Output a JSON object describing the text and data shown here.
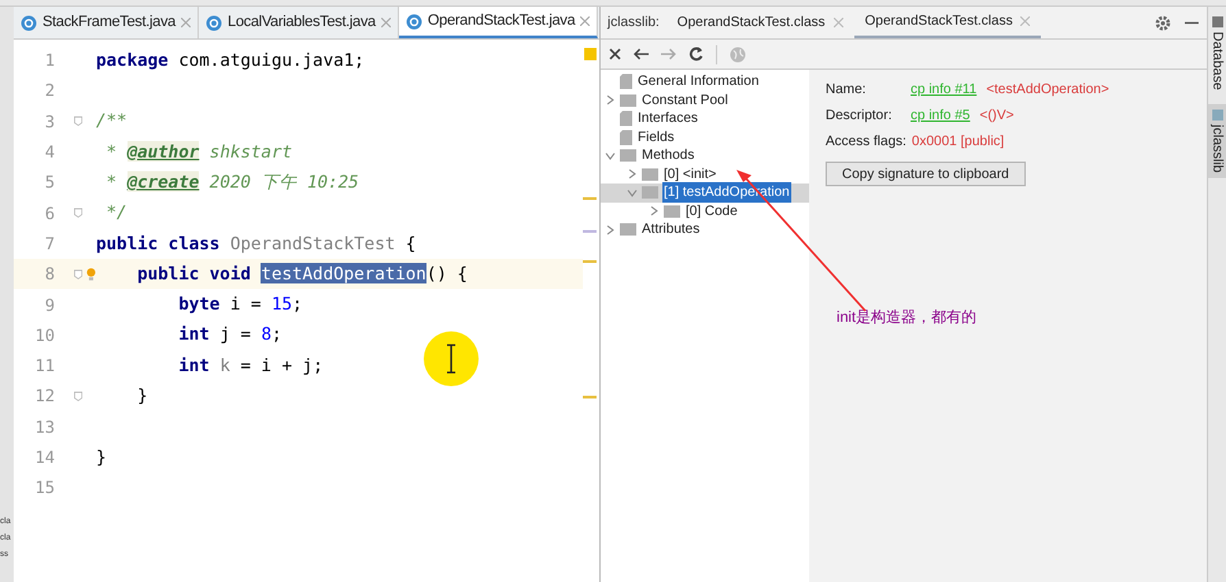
{
  "editor_tabs": [
    {
      "label": "StackFrameTest.java",
      "selected": false
    },
    {
      "label": "LocalVariablesTest.java",
      "selected": false
    },
    {
      "label": "OperandStackTest.java",
      "selected": true
    }
  ],
  "left_strip": [
    "cla",
    "cla",
    "ss"
  ],
  "code_lines": [
    {
      "number": "1",
      "tokens": [
        {
          "kind": "keyword",
          "text": "package"
        },
        {
          "kind": "plain",
          "text": " com.atguigu.java1;"
        }
      ]
    },
    {
      "number": "2"
    },
    {
      "number": "3",
      "fold": true,
      "tokens": [
        {
          "kind": "comment",
          "text": "/**"
        }
      ]
    },
    {
      "number": "4",
      "tokens": [
        {
          "kind": "comment",
          "text": " * "
        },
        {
          "kind": "tag",
          "text": "@author"
        },
        {
          "kind": "comment",
          "text": " shkstart"
        }
      ]
    },
    {
      "number": "5",
      "tokens": [
        {
          "kind": "comment",
          "text": " * "
        },
        {
          "kind": "tag",
          "text": "@create"
        },
        {
          "kind": "comment",
          "text": " 2020 下午 10:25"
        }
      ]
    },
    {
      "number": "6",
      "fold": true,
      "tokens": [
        {
          "kind": "comment",
          "text": " */"
        }
      ]
    },
    {
      "number": "7",
      "tokens": [
        {
          "kind": "keyword",
          "text": "public class "
        },
        {
          "kind": "unused",
          "text": "OperandStackTest"
        },
        {
          "kind": "plain",
          "text": " {"
        }
      ]
    },
    {
      "number": "8",
      "fold": true,
      "current": true,
      "bulb": true,
      "tokens": [
        {
          "kind": "keyword",
          "text": "    public void "
        },
        {
          "kind": "selected",
          "text": "testAddOperation"
        },
        {
          "kind": "plain",
          "text": "() {"
        }
      ]
    },
    {
      "number": "9",
      "tokens": [
        {
          "kind": "keyword",
          "text": "        byte"
        },
        {
          "kind": "plain",
          "text": " i = "
        },
        {
          "kind": "number",
          "text": "15"
        },
        {
          "kind": "plain",
          "text": ";"
        }
      ]
    },
    {
      "number": "10",
      "tokens": [
        {
          "kind": "keyword",
          "text": "        int"
        },
        {
          "kind": "plain",
          "text": " j = "
        },
        {
          "kind": "number",
          "text": "8"
        },
        {
          "kind": "plain",
          "text": ";"
        }
      ]
    },
    {
      "number": "11",
      "tokens": [
        {
          "kind": "keyword",
          "text": "        int"
        },
        {
          "kind": "unused",
          "text": " k"
        },
        {
          "kind": "plain",
          "text": " = i + j;"
        }
      ]
    },
    {
      "number": "12",
      "fold": true,
      "tokens": [
        {
          "kind": "plain",
          "text": "    }"
        }
      ]
    },
    {
      "number": "13"
    },
    {
      "number": "14",
      "tokens": [
        {
          "kind": "plain",
          "text": "}"
        }
      ]
    },
    {
      "number": "15"
    }
  ],
  "jclasslib": {
    "label": "jclasslib:",
    "tabs": [
      {
        "label": "OperandStackTest.class",
        "selected": false
      },
      {
        "label": "OperandStackTest.class",
        "selected": true
      }
    ],
    "tree": [
      {
        "label": "General Information",
        "kind": "file"
      },
      {
        "label": "Constant Pool",
        "kind": "folder",
        "expanded": false
      },
      {
        "label": "Interfaces",
        "kind": "file"
      },
      {
        "label": "Fields",
        "kind": "file"
      },
      {
        "label": "Methods",
        "kind": "folder",
        "expanded": true,
        "children": [
          {
            "label": "[0] <init>",
            "kind": "folder",
            "expanded": false,
            "selected": false
          },
          {
            "label": "[1] testAddOperation",
            "kind": "folder",
            "expanded": true,
            "selected": true,
            "children": [
              {
                "label": "[0] Code",
                "kind": "folder",
                "expanded": false,
                "selected": false
              }
            ]
          }
        ]
      },
      {
        "label": "Attributes",
        "kind": "folder",
        "expanded": false
      }
    ],
    "details": [
      {
        "label": "Name:",
        "link": "cp info #11",
        "value": "<testAddOperation>"
      },
      {
        "label": "Descriptor:",
        "link": "cp info #5",
        "value": "<()V>"
      },
      {
        "label": "Access flags:",
        "value": "0x0001 [public]"
      }
    ],
    "copy_button": "Copy signature to clipboard"
  },
  "annotation": "init是构造器，都有的",
  "side_tabs": [
    {
      "label": "Database",
      "selected": false
    },
    {
      "label": "jclasslib",
      "selected": true
    }
  ]
}
